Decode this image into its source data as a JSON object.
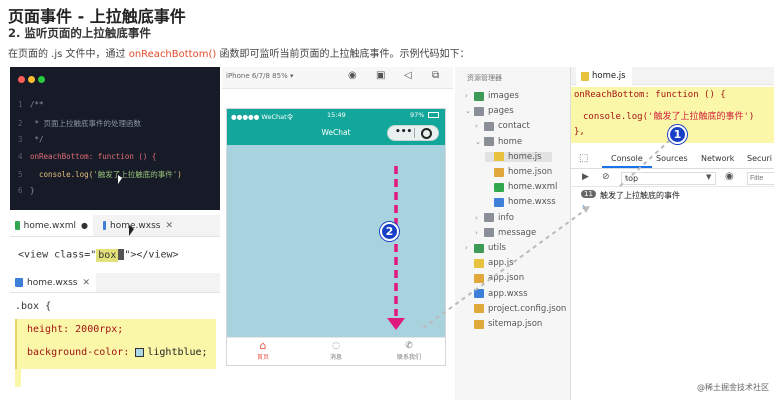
{
  "heading": "页面事件 - 上拉触底事件",
  "subheading": "2. 监听页面的上拉触底事件",
  "description": {
    "before": "在页面的 .js 文件中，通过 ",
    "highlight": "onReachBottom()",
    "after": " 函数即可监听当前页面的上拉触底事件。示例代码如下："
  },
  "dark_code": {
    "lines": [
      {
        "n": "1",
        "code": "/**"
      },
      {
        "n": "2",
        "code": " * 页面上拉触底事件的处理函数"
      },
      {
        "n": "3",
        "code": " */"
      },
      {
        "n": "4",
        "fn": "onReachBottom",
        "rest": ": function () {"
      },
      {
        "n": "5",
        "code": "  console.log(",
        "str": "'触发了上拉触底的事件'",
        "end": ")"
      },
      {
        "n": "6",
        "code": "}"
      }
    ]
  },
  "wxml_editor": {
    "tab1": "home.wxml",
    "tab2": "home.wxss",
    "code_prefix": "<view class=\"",
    "code_class": "box",
    "code_suffix": "\"></view>"
  },
  "wxss_editor": {
    "tab": "home.wxss",
    "selector": ".box {",
    "line1": "height: 2000rpx;",
    "line2_prop": "background-color: ",
    "line2_value": "lightblue;"
  },
  "simulator": {
    "device": "iPhone 6/7/8 85% ▾",
    "status_carrier": "●●●●● WeChat令",
    "status_time": "15:49",
    "status_battery": "97%",
    "nav_title": "WeChat",
    "capsule_dots": "•••",
    "tabs": [
      "首页",
      "消息",
      "联系我们"
    ]
  },
  "explorer": {
    "title": "资源管理器",
    "items": [
      {
        "label": "images",
        "indent": 0,
        "chev": "›",
        "type": "folder-green"
      },
      {
        "label": "pages",
        "indent": 0,
        "chev": "⌄",
        "type": "folder"
      },
      {
        "label": "contact",
        "indent": 1,
        "chev": "›",
        "type": "folder"
      },
      {
        "label": "home",
        "indent": 1,
        "chev": "⌄",
        "type": "folder"
      },
      {
        "label": "home.js",
        "indent": 2,
        "chev": "",
        "type": "js",
        "selected": true
      },
      {
        "label": "home.json",
        "indent": 2,
        "chev": "",
        "type": "json"
      },
      {
        "label": "home.wxml",
        "indent": 2,
        "chev": "",
        "type": "wxml"
      },
      {
        "label": "home.wxss",
        "indent": 2,
        "chev": "",
        "type": "wxss"
      },
      {
        "label": "info",
        "indent": 1,
        "chev": "›",
        "type": "folder"
      },
      {
        "label": "message",
        "indent": 1,
        "chev": "›",
        "type": "folder"
      },
      {
        "label": "utils",
        "indent": 0,
        "chev": "›",
        "type": "folder-green"
      },
      {
        "label": "app.js",
        "indent": 0,
        "chev": "",
        "type": "js"
      },
      {
        "label": "app.json",
        "indent": 0,
        "chev": "",
        "type": "json"
      },
      {
        "label": "app.wxss",
        "indent": 0,
        "chev": "",
        "type": "wxss"
      },
      {
        "label": "project.config.json",
        "indent": 0,
        "chev": "",
        "type": "json"
      },
      {
        "label": "sitemap.json",
        "indent": 0,
        "chev": "",
        "type": "json"
      }
    ]
  },
  "js_editor": {
    "tab": "home.js",
    "line1": "onReachBottom: function () {",
    "line2_prefix": "console.log(",
    "line2_str": "'触发了上拉触底的事件'",
    "line2_suffix": ")",
    "line3": "},"
  },
  "devtools": {
    "tabs": [
      "Console",
      "Sources",
      "Network",
      "Securi"
    ],
    "context": "top",
    "filter_placeholder": "Filte",
    "log_count": "11",
    "log_message": "触发了上拉触底的事件",
    "prompt": "›"
  },
  "callouts": [
    "1",
    "2"
  ],
  "watermark": "@稀土掘金技术社区",
  "colors": {
    "accent_red": "#e34b2c",
    "wechat_teal": "#12a79a",
    "page_blue": "#a9d2df",
    "highlight_yellow": "#fbf7a8",
    "arrow_magenta": "#e0197e",
    "callout_blue": "#1740c6"
  }
}
